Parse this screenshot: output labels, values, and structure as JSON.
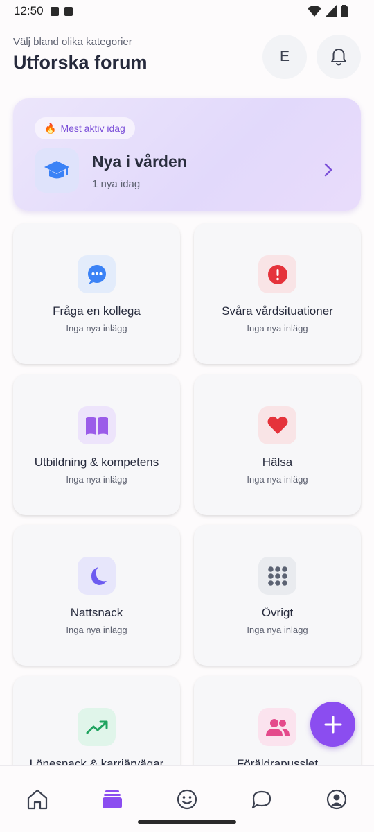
{
  "status_bar": {
    "time": "12:50"
  },
  "header": {
    "subtitle": "Välj bland olika kategorier",
    "title": "Utforska forum",
    "avatar_initial": "E"
  },
  "featured": {
    "badge_emoji": "🔥",
    "badge_label": "Mest aktiv idag",
    "title": "Nya i vården",
    "subtitle": "1 nya idag",
    "icon": "graduation-cap-icon"
  },
  "categories": [
    {
      "name": "Fråga en kollega",
      "status": "Inga nya inlägg",
      "icon": "chat-bubble-icon",
      "color": "#3b82f6",
      "bg": "#e3ecfb"
    },
    {
      "name": "Svåra vårdsituationer",
      "status": "Inga nya inlägg",
      "icon": "alert-icon",
      "color": "#e5333b",
      "bg": "#f9e4e6"
    },
    {
      "name": "Utbildning & kompetens",
      "status": "Inga nya inlägg",
      "icon": "book-icon",
      "color": "#9b5ce9",
      "bg": "#ede4fb"
    },
    {
      "name": "Hälsa",
      "status": "Inga nya inlägg",
      "icon": "heart-icon",
      "color": "#e5333b",
      "bg": "#f9e4e6"
    },
    {
      "name": "Nattsnack",
      "status": "Inga nya inlägg",
      "icon": "moon-icon",
      "color": "#6d5cf0",
      "bg": "#e7e6fb"
    },
    {
      "name": "Övrigt",
      "status": "Inga nya inlägg",
      "icon": "grid-dots-icon",
      "color": "#5b6272",
      "bg": "#e9ebef"
    },
    {
      "name": "Lönesnack & karriärvägar",
      "status": "",
      "icon": "trending-up-icon",
      "color": "#1fa35f",
      "bg": "#e0f5ea"
    },
    {
      "name": "Föräldrapusslet",
      "status": "",
      "icon": "users-icon",
      "color": "#e44a8b",
      "bg": "#fbe3ee"
    }
  ],
  "nav": {
    "items": [
      {
        "name": "home",
        "icon": "home-icon"
      },
      {
        "name": "forum",
        "icon": "forum-stack-icon",
        "active": true
      },
      {
        "name": "mood",
        "icon": "smiley-icon"
      },
      {
        "name": "messages",
        "icon": "chat-icon"
      },
      {
        "name": "profile",
        "icon": "profile-icon"
      }
    ]
  },
  "colors": {
    "accent": "#8b4df0",
    "nav_active": "#8b4df0"
  }
}
